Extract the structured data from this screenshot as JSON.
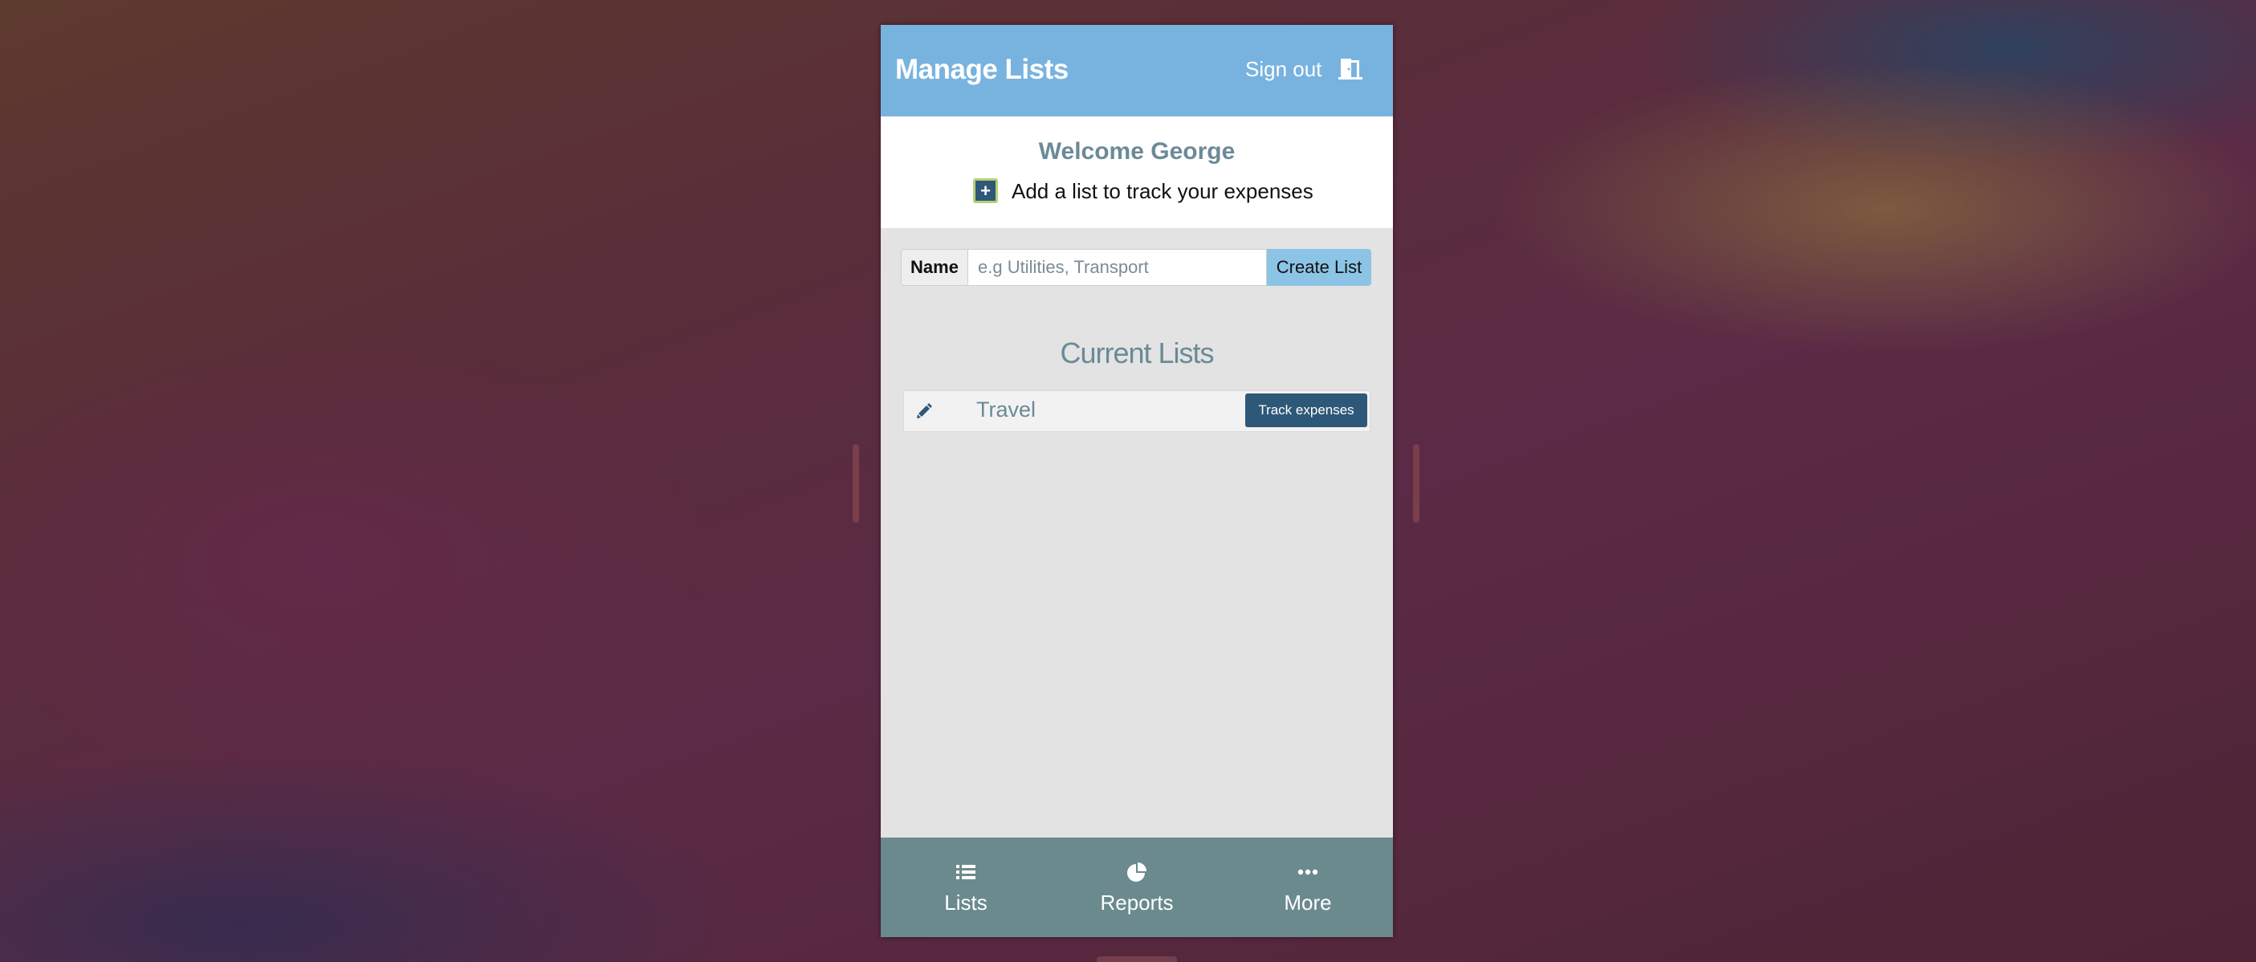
{
  "header": {
    "title": "Manage Lists",
    "signout_label": "Sign out",
    "signout_icon": "door-exit-icon",
    "background_color": "#78b3e0"
  },
  "welcome": {
    "greeting": "Welcome George",
    "add_prompt": "Add a list to track your expenses",
    "add_icon": "plus-icon"
  },
  "form": {
    "name_label": "Name",
    "name_value": "",
    "name_placeholder": "e.g Utilities, Transport",
    "create_label": "Create List"
  },
  "current_lists": {
    "title": "Current Lists",
    "items": [
      {
        "name": "Travel",
        "edit_icon": "pencil-icon",
        "action_label": "Track expenses"
      }
    ]
  },
  "tabs": [
    {
      "label": "Lists",
      "icon": "list-icon"
    },
    {
      "label": "Reports",
      "icon": "pie-chart-icon"
    },
    {
      "label": "More",
      "icon": "ellipsis-icon"
    }
  ],
  "colors": {
    "accent_dark": "#2e5878",
    "muted_text": "#6b8a96",
    "tabbar": "#6b8a8e",
    "create_button": "#8cc4e6"
  }
}
